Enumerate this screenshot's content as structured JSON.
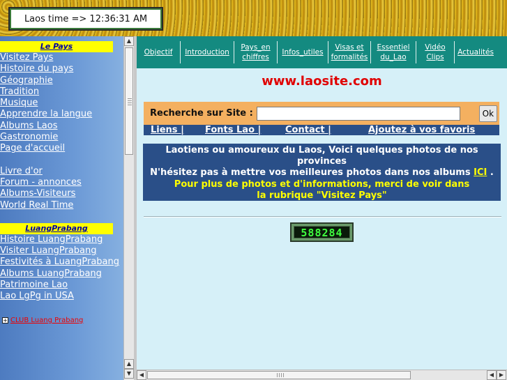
{
  "banner": {
    "time_label": "Laos time => 12:36:31 AM"
  },
  "sidebar": {
    "section1_title": "Le Pays",
    "section1_items": [
      "Visitez Pays",
      "Histoire du pays",
      "Géographie",
      "Tradition",
      "Musique",
      "Apprendre la langue",
      "Albums Laos",
      "Gastronomie",
      "Page d'accueil"
    ],
    "section1b_items": [
      "Livre d'or",
      "Forum - annonces",
      "Albums-Visiteurs",
      "World Real Time"
    ],
    "section2_title": "LuangPrabang",
    "section2_items": [
      "Histoire LuangPrabang",
      "Visiter LuangPrabang",
      "Festivités à LuangPrabang",
      "Albums LuangPrabang",
      "Patrimoine Lao",
      "Lao LgPg in USA"
    ],
    "club_label": "CLUB Luang Prabang"
  },
  "topnav": {
    "items": [
      "Objectif",
      "Introduction",
      "Pays_en chiffres",
      "Infos_utiles",
      "Visas et formalités",
      "Essentiel du_Lao",
      "Vidéo Clips",
      "Actualités"
    ]
  },
  "main": {
    "site_title": "www.laosite.com",
    "search_label": "Recherche sur Site :",
    "search_value": "",
    "ok_label": "Ok",
    "links": [
      "Liens |",
      "Fonts Lao |",
      "Contact |",
      "Ajoutez à vos favoris"
    ],
    "info_line1": "Laotiens ou amoureux du Laos, Voici quelques photos de nos provinces",
    "info_line2": "N'hésitez pas à mettre vos meilleures photos dans nos albums",
    "info_ici": "ICI",
    "info_dot": " .",
    "info_line3": "Pour plus de photos et d'informations, merci de voir dans la rubrique \"Visitez Pays\"",
    "counter": "588284"
  }
}
